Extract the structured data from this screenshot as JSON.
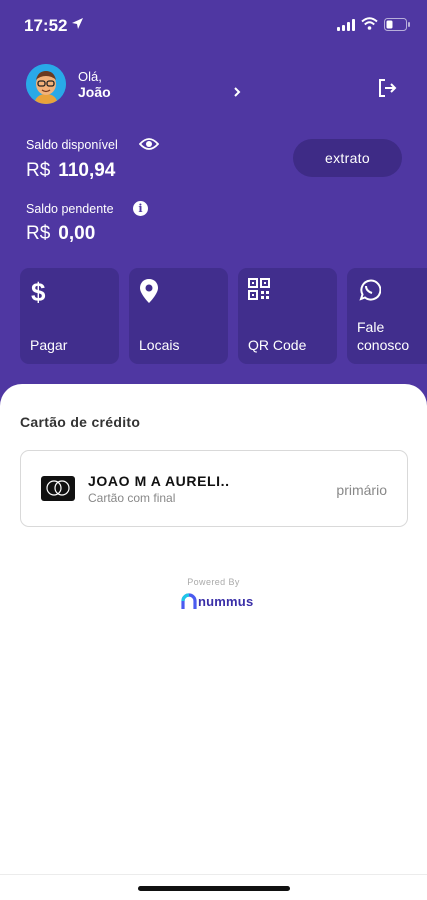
{
  "status_bar": {
    "time": "17:52"
  },
  "user": {
    "greeting": "Olá,",
    "name": "João"
  },
  "balance": {
    "available_label": "Saldo disponível",
    "currency": "R$",
    "available_value": "110,94",
    "pending_label": "Saldo pendente",
    "pending_value": "0,00",
    "info_glyph": "i"
  },
  "extrato_button": {
    "label": "extrato"
  },
  "actions": [
    {
      "label": "Pagar",
      "icon": "dollar-icon"
    },
    {
      "label": "Locais",
      "icon": "location-pin-icon"
    },
    {
      "label": "QR Code",
      "icon": "qr-code-icon"
    },
    {
      "label": "Fale conosco",
      "icon": "whatsapp-icon"
    }
  ],
  "credit_card": {
    "section_title": "Cartão de crédito",
    "holder_name": "JOAO M A AURELI..",
    "subtitle": "Cartão com final",
    "tag": "primário"
  },
  "footer": {
    "powered_by": "Powered By",
    "brand": "nummus"
  },
  "colors": {
    "primary": "#4f37a2",
    "tile": "#412e8d",
    "button": "#3e2b86"
  }
}
